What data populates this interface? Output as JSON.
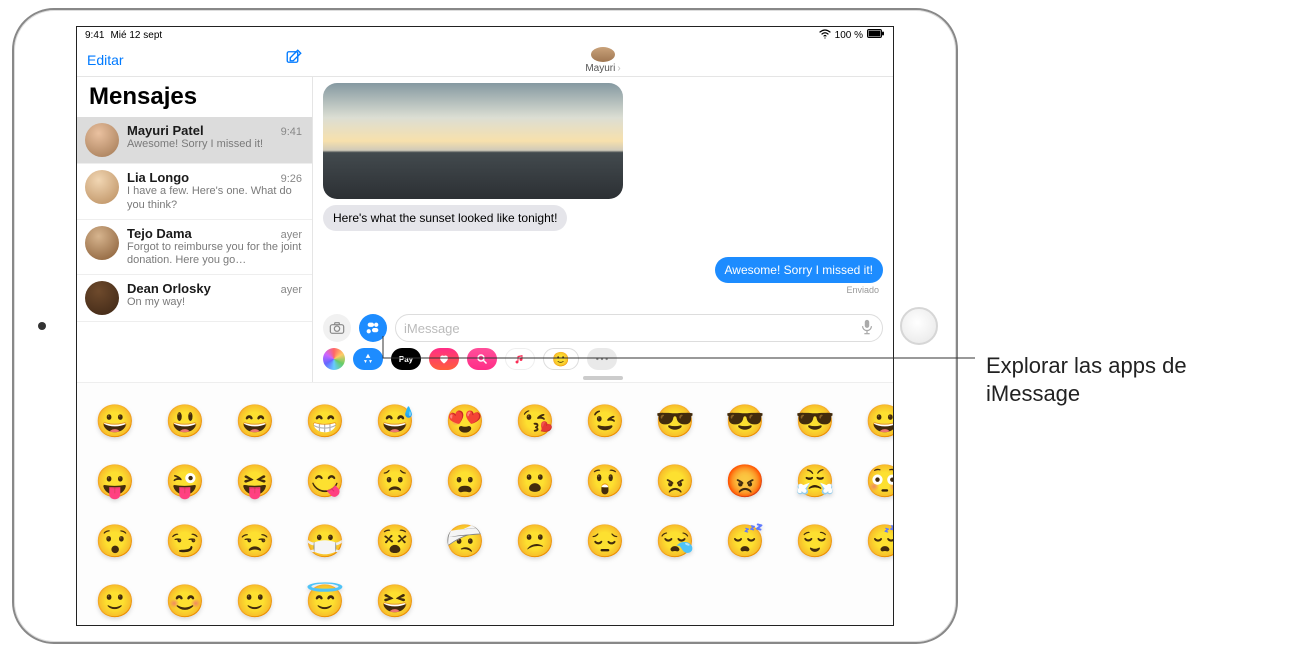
{
  "status": {
    "time": "9:41",
    "date": "Mié 12 sept",
    "battery": "100 %",
    "battery_icon": "■"
  },
  "sidebar": {
    "edit": "Editar",
    "title": "Mensajes"
  },
  "threads": [
    {
      "name": "Mayuri Patel",
      "time": "9:41",
      "preview": "Awesome! Sorry I missed it!"
    },
    {
      "name": "Lia Longo",
      "time": "9:26",
      "preview": "I have a few. Here's one. What do you think?"
    },
    {
      "name": "Tejo Dama",
      "time": "ayer",
      "preview": "Forgot to reimburse you for the joint donation. Here you go…"
    },
    {
      "name": "Dean Orlosky",
      "time": "ayer",
      "preview": "On my way!"
    }
  ],
  "conversation": {
    "contact": "Mayuri",
    "incoming_text": "Here's what the sunset looked like tonight!",
    "outgoing_text": "Awesome! Sorry I missed it!",
    "status_label": "Enviado"
  },
  "composer": {
    "placeholder": "iMessage"
  },
  "app_drawer": {
    "photos": "Photos",
    "store": "App Store",
    "apple_pay": "Pay",
    "digital_touch": "Digital Touch",
    "images_search": "#images",
    "music": "Music",
    "stickers": "Stickers",
    "more": "More"
  },
  "stickers": {
    "rows": [
      [
        "😀",
        "😃",
        "😄",
        "😁",
        "😅",
        "😍",
        "😘",
        "😉",
        "😎",
        "😎",
        "😎",
        "😀"
      ],
      [
        "😛",
        "😜",
        "😝",
        "😋",
        "😟",
        "😦",
        "😮",
        "😲",
        "😠",
        "😡",
        "😤",
        "😳"
      ],
      [
        "😯",
        "😏",
        "😒",
        "😷",
        "😵",
        "🤕",
        "😕",
        "😔",
        "😪",
        "😴",
        "😌",
        "😴"
      ],
      [
        "🙂",
        "😊",
        "🙂",
        "😇",
        "😆"
      ]
    ]
  },
  "callout": {
    "text": "Explorar las apps de iMessage"
  }
}
